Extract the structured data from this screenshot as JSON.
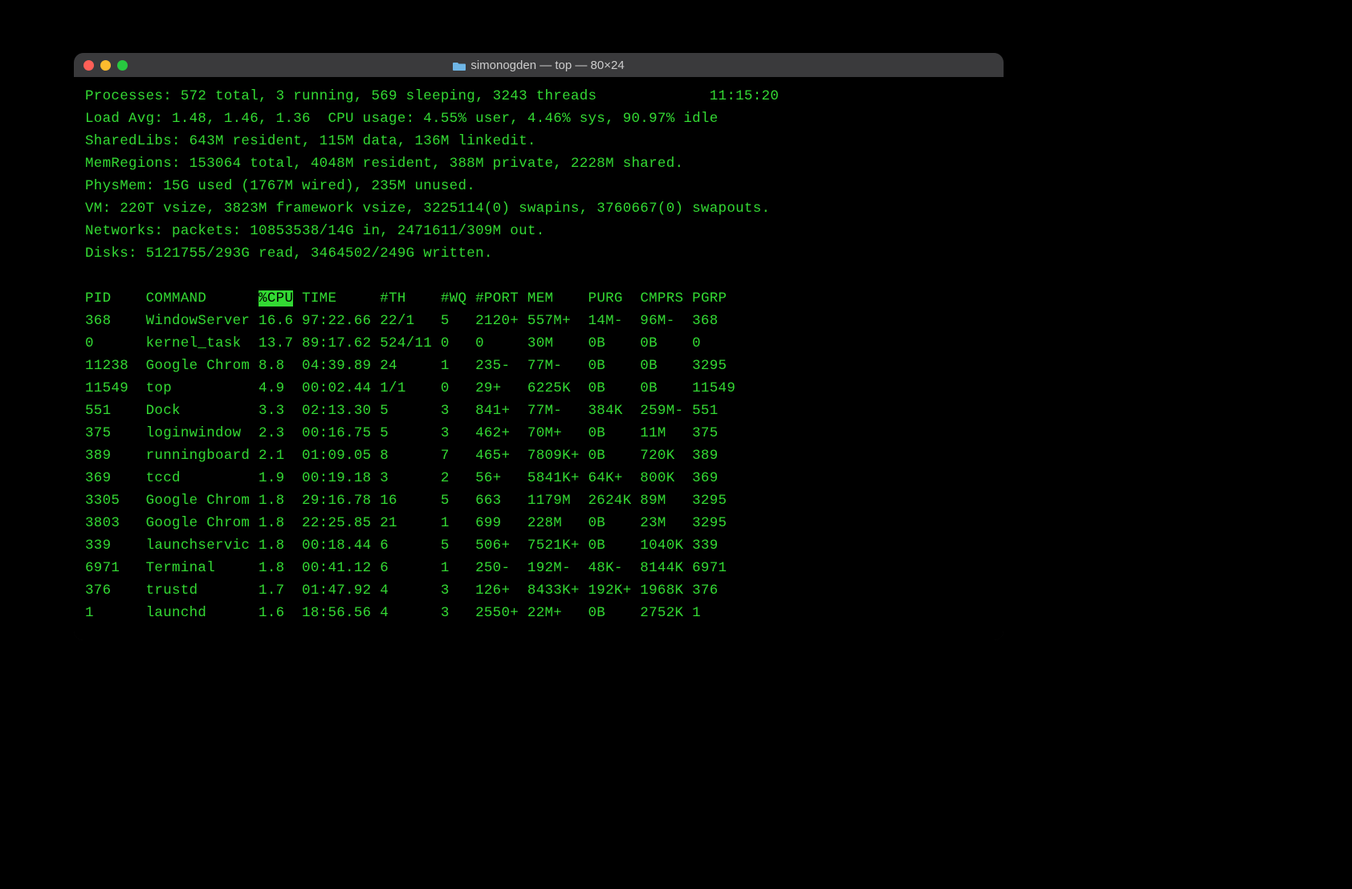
{
  "window": {
    "title": "simonogden — top — 80×24"
  },
  "summary": {
    "processes_line_left": "Processes: 572 total, 3 running, 569 sleeping, 3243 threads",
    "clock": "11:15:20",
    "load_line": "Load Avg: 1.48, 1.46, 1.36  CPU usage: 4.55% user, 4.46% sys, 90.97% idle",
    "sharedlibs_line": "SharedLibs: 643M resident, 115M data, 136M linkedit.",
    "memregions_line": "MemRegions: 153064 total, 4048M resident, 388M private, 2228M shared.",
    "physmem_line": "PhysMem: 15G used (1767M wired), 235M unused.",
    "vm_line": "VM: 220T vsize, 3823M framework vsize, 3225114(0) swapins, 3760667(0) swapouts.",
    "networks_line": "Networks: packets: 10853538/14G in, 2471611/309M out.",
    "disks_line": "Disks: 5121755/293G read, 3464502/249G written."
  },
  "columns": {
    "pid": "PID",
    "cmd": "COMMAND",
    "cpu": "%CPU",
    "time": "TIME",
    "th": "#TH",
    "wq": "#WQ",
    "port": "#PORT",
    "mem": "MEM",
    "purg": "PURG",
    "cmprs": "CMPRS",
    "pgrp": "PGRP"
  },
  "rows": [
    {
      "pid": "368",
      "cmd": "WindowServer",
      "cpu": "16.6",
      "time": "97:22.66",
      "th": "22/1",
      "wq": "5",
      "port": "2120+",
      "mem": "557M+",
      "purg": "14M-",
      "cmprs": "96M-",
      "pgrp": "368"
    },
    {
      "pid": "0",
      "cmd": "kernel_task",
      "cpu": "13.7",
      "time": "89:17.62",
      "th": "524/11",
      "wq": "0",
      "port": "0",
      "mem": "30M",
      "purg": "0B",
      "cmprs": "0B",
      "pgrp": "0"
    },
    {
      "pid": "11238",
      "cmd": "Google Chrom",
      "cpu": "8.8",
      "time": "04:39.89",
      "th": "24",
      "wq": "1",
      "port": "235-",
      "mem": "77M-",
      "purg": "0B",
      "cmprs": "0B",
      "pgrp": "3295"
    },
    {
      "pid": "11549",
      "cmd": "top",
      "cpu": "4.9",
      "time": "00:02.44",
      "th": "1/1",
      "wq": "0",
      "port": "29+",
      "mem": "6225K",
      "purg": "0B",
      "cmprs": "0B",
      "pgrp": "11549"
    },
    {
      "pid": "551",
      "cmd": "Dock",
      "cpu": "3.3",
      "time": "02:13.30",
      "th": "5",
      "wq": "3",
      "port": "841+",
      "mem": "77M-",
      "purg": "384K",
      "cmprs": "259M-",
      "pgrp": "551"
    },
    {
      "pid": "375",
      "cmd": "loginwindow",
      "cpu": "2.3",
      "time": "00:16.75",
      "th": "5",
      "wq": "3",
      "port": "462+",
      "mem": "70M+",
      "purg": "0B",
      "cmprs": "11M",
      "pgrp": "375"
    },
    {
      "pid": "389",
      "cmd": "runningboard",
      "cpu": "2.1",
      "time": "01:09.05",
      "th": "8",
      "wq": "7",
      "port": "465+",
      "mem": "7809K+",
      "purg": "0B",
      "cmprs": "720K",
      "pgrp": "389"
    },
    {
      "pid": "369",
      "cmd": "tccd",
      "cpu": "1.9",
      "time": "00:19.18",
      "th": "3",
      "wq": "2",
      "port": "56+",
      "mem": "5841K+",
      "purg": "64K+",
      "cmprs": "800K",
      "pgrp": "369"
    },
    {
      "pid": "3305",
      "cmd": "Google Chrom",
      "cpu": "1.8",
      "time": "29:16.78",
      "th": "16",
      "wq": "5",
      "port": "663",
      "mem": "1179M",
      "purg": "2624K",
      "cmprs": "89M",
      "pgrp": "3295"
    },
    {
      "pid": "3803",
      "cmd": "Google Chrom",
      "cpu": "1.8",
      "time": "22:25.85",
      "th": "21",
      "wq": "1",
      "port": "699",
      "mem": "228M",
      "purg": "0B",
      "cmprs": "23M",
      "pgrp": "3295"
    },
    {
      "pid": "339",
      "cmd": "launchservic",
      "cpu": "1.8",
      "time": "00:18.44",
      "th": "6",
      "wq": "5",
      "port": "506+",
      "mem": "7521K+",
      "purg": "0B",
      "cmprs": "1040K",
      "pgrp": "339"
    },
    {
      "pid": "6971",
      "cmd": "Terminal",
      "cpu": "1.8",
      "time": "00:41.12",
      "th": "6",
      "wq": "1",
      "port": "250-",
      "mem": "192M-",
      "purg": "48K-",
      "cmprs": "8144K",
      "pgrp": "6971"
    },
    {
      "pid": "376",
      "cmd": "trustd",
      "cpu": "1.7",
      "time": "01:47.92",
      "th": "4",
      "wq": "3",
      "port": "126+",
      "mem": "8433K+",
      "purg": "192K+",
      "cmprs": "1968K",
      "pgrp": "376"
    },
    {
      "pid": "1",
      "cmd": "launchd",
      "cpu": "1.6",
      "time": "18:56.56",
      "th": "4",
      "wq": "3",
      "port": "2550+",
      "mem": "22M+",
      "purg": "0B",
      "cmprs": "2752K",
      "pgrp": "1"
    }
  ]
}
